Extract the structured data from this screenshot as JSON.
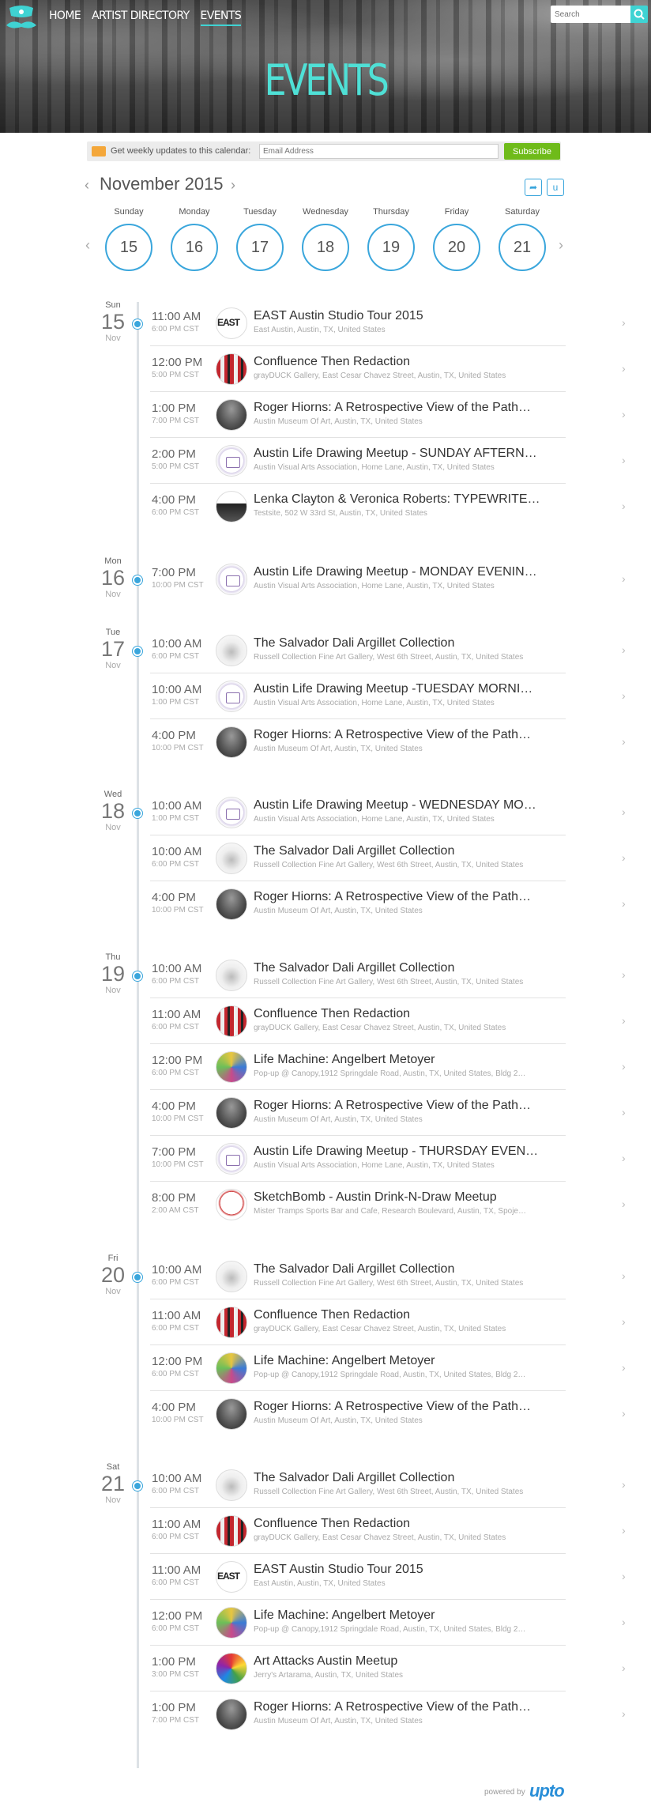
{
  "nav": {
    "items": [
      {
        "label": "HOME",
        "active": false
      },
      {
        "label": "ARTIST DIRECTORY",
        "active": false
      },
      {
        "label": "EVENTS",
        "active": true
      }
    ],
    "search_placeholder": "Search"
  },
  "hero": {
    "title": "EVENTS"
  },
  "subscribe": {
    "label": "Get weekly updates to this calendar:",
    "email_placeholder": "Email Address",
    "button": "Subscribe"
  },
  "calendar": {
    "month": "November 2015",
    "days": [
      {
        "dow": "Sunday",
        "num": "15"
      },
      {
        "dow": "Monday",
        "num": "16"
      },
      {
        "dow": "Tuesday",
        "num": "17"
      },
      {
        "dow": "Wednesday",
        "num": "18"
      },
      {
        "dow": "Thursday",
        "num": "19"
      },
      {
        "dow": "Friday",
        "num": "20"
      },
      {
        "dow": "Saturday",
        "num": "21"
      }
    ]
  },
  "colors": {
    "accent": "#3aa6dc",
    "teal": "#3fd3d3",
    "title": "#4fe0d6",
    "subscribe": "#6fbb1a"
  },
  "schedule": [
    {
      "dow": "Sun",
      "num": "15",
      "mon": "Nov",
      "events": [
        {
          "time": "11:00 AM",
          "end": "6:00 PM CST",
          "title": "EAST Austin Studio Tour 2015",
          "loc": "East Austin, Austin, TX, United States",
          "thumb": "east"
        },
        {
          "time": "12:00 PM",
          "end": "5:00 PM CST",
          "title": "Confluence Then Redaction",
          "loc": "grayDUCK Gallery, East Cesar Chavez Street, Austin, TX, United States",
          "thumb": "conf"
        },
        {
          "time": "1:00 PM",
          "end": "7:00 PM CST",
          "title": "Roger Hiorns: A Retrospective View of the Path…",
          "loc": "Austin Museum Of Art, Austin, TX, United States",
          "thumb": "roger"
        },
        {
          "time": "2:00 PM",
          "end": "5:00 PM CST",
          "title": "Austin Life Drawing Meetup - SUNDAY AFTERN…",
          "loc": "Austin Visual Arts Association, Home Lane, Austin, TX, United States",
          "thumb": "draw"
        },
        {
          "time": "4:00 PM",
          "end": "6:00 PM CST",
          "title": "Lenka Clayton & Veronica Roberts: TYPEWRITE…",
          "loc": "Testsite, 502 W 33rd St, Austin, TX, United States",
          "thumb": "lenka"
        }
      ]
    },
    {
      "dow": "Mon",
      "num": "16",
      "mon": "Nov",
      "events": [
        {
          "time": "7:00 PM",
          "end": "10:00 PM CST",
          "title": "Austin Life Drawing Meetup - MONDAY EVENIN…",
          "loc": "Austin Visual Arts Association, Home Lane, Austin, TX, United States",
          "thumb": "draw"
        }
      ]
    },
    {
      "dow": "Tue",
      "num": "17",
      "mon": "Nov",
      "events": [
        {
          "time": "10:00 AM",
          "end": "6:00 PM CST",
          "title": "The Salvador Dali Argillet Collection",
          "loc": "Russell Collection Fine Art Gallery, West 6th Street, Austin, TX, United States",
          "thumb": "dali"
        },
        {
          "time": "10:00 AM",
          "end": "1:00 PM CST",
          "title": "Austin Life Drawing Meetup -TUESDAY MORNI…",
          "loc": "Austin Visual Arts Association, Home Lane, Austin, TX, United States",
          "thumb": "draw"
        },
        {
          "time": "4:00 PM",
          "end": "10:00 PM CST",
          "title": "Roger Hiorns: A Retrospective View of the Path…",
          "loc": "Austin Museum Of Art, Austin, TX, United States",
          "thumb": "roger"
        }
      ]
    },
    {
      "dow": "Wed",
      "num": "18",
      "mon": "Nov",
      "events": [
        {
          "time": "10:00 AM",
          "end": "1:00 PM CST",
          "title": "Austin Life Drawing Meetup - WEDNESDAY MO…",
          "loc": "Austin Visual Arts Association, Home Lane, Austin, TX, United States",
          "thumb": "draw"
        },
        {
          "time": "10:00 AM",
          "end": "6:00 PM CST",
          "title": "The Salvador Dali Argillet Collection",
          "loc": "Russell Collection Fine Art Gallery, West 6th Street, Austin, TX, United States",
          "thumb": "dali"
        },
        {
          "time": "4:00 PM",
          "end": "10:00 PM CST",
          "title": "Roger Hiorns: A Retrospective View of the Path…",
          "loc": "Austin Museum Of Art, Austin, TX, United States",
          "thumb": "roger"
        }
      ]
    },
    {
      "dow": "Thu",
      "num": "19",
      "mon": "Nov",
      "events": [
        {
          "time": "10:00 AM",
          "end": "6:00 PM CST",
          "title": "The Salvador Dali Argillet Collection",
          "loc": "Russell Collection Fine Art Gallery, West 6th Street, Austin, TX, United States",
          "thumb": "dali"
        },
        {
          "time": "11:00 AM",
          "end": "6:00 PM CST",
          "title": "Confluence Then Redaction",
          "loc": "grayDUCK Gallery, East Cesar Chavez Street, Austin, TX, United States",
          "thumb": "conf"
        },
        {
          "time": "12:00 PM",
          "end": "6:00 PM CST",
          "title": "Life Machine: Angelbert Metoyer",
          "loc": "Pop-up @ Canopy,1912 Springdale Road, Austin, TX, United States, Bldg 2…",
          "thumb": "life"
        },
        {
          "time": "4:00 PM",
          "end": "10:00 PM CST",
          "title": "Roger Hiorns: A Retrospective View of the Path…",
          "loc": "Austin Museum Of Art, Austin, TX, United States",
          "thumb": "roger"
        },
        {
          "time": "7:00 PM",
          "end": "10:00 PM CST",
          "title": "Austin Life Drawing Meetup - THURSDAY EVEN…",
          "loc": "Austin Visual Arts Association, Home Lane, Austin, TX, United States",
          "thumb": "draw"
        },
        {
          "time": "8:00 PM",
          "end": "2:00 AM CST",
          "title": "SketchBomb - Austin Drink-N-Draw Meetup",
          "loc": "Mister Tramps Sports Bar and Cafe, Research Boulevard, Austin, TX, Spoje…",
          "thumb": "sketch"
        }
      ]
    },
    {
      "dow": "Fri",
      "num": "20",
      "mon": "Nov",
      "events": [
        {
          "time": "10:00 AM",
          "end": "6:00 PM CST",
          "title": "The Salvador Dali Argillet Collection",
          "loc": "Russell Collection Fine Art Gallery, West 6th Street, Austin, TX, United States",
          "thumb": "dali"
        },
        {
          "time": "11:00 AM",
          "end": "6:00 PM CST",
          "title": "Confluence Then Redaction",
          "loc": "grayDUCK Gallery, East Cesar Chavez Street, Austin, TX, United States",
          "thumb": "conf"
        },
        {
          "time": "12:00 PM",
          "end": "6:00 PM CST",
          "title": "Life Machine: Angelbert Metoyer",
          "loc": "Pop-up @ Canopy,1912 Springdale Road, Austin, TX, United States, Bldg 2…",
          "thumb": "life"
        },
        {
          "time": "4:00 PM",
          "end": "10:00 PM CST",
          "title": "Roger Hiorns: A Retrospective View of the Path…",
          "loc": "Austin Museum Of Art, Austin, TX, United States",
          "thumb": "roger"
        }
      ]
    },
    {
      "dow": "Sat",
      "num": "21",
      "mon": "Nov",
      "events": [
        {
          "time": "10:00 AM",
          "end": "6:00 PM CST",
          "title": "The Salvador Dali Argillet Collection",
          "loc": "Russell Collection Fine Art Gallery, West 6th Street, Austin, TX, United States",
          "thumb": "dali"
        },
        {
          "time": "11:00 AM",
          "end": "6:00 PM CST",
          "title": "Confluence Then Redaction",
          "loc": "grayDUCK Gallery, East Cesar Chavez Street, Austin, TX, United States",
          "thumb": "conf"
        },
        {
          "time": "11:00 AM",
          "end": "6:00 PM CST",
          "title": "EAST Austin Studio Tour 2015",
          "loc": "East Austin, Austin, TX, United States",
          "thumb": "east"
        },
        {
          "time": "12:00 PM",
          "end": "6:00 PM CST",
          "title": "Life Machine: Angelbert Metoyer",
          "loc": "Pop-up @ Canopy,1912 Springdale Road, Austin, TX, United States, Bldg 2…",
          "thumb": "life"
        },
        {
          "time": "1:00 PM",
          "end": "3:00 PM CST",
          "title": "Art Attacks Austin Meetup",
          "loc": "Jerry's Artarama, Austin, TX, United States",
          "thumb": "artatt"
        },
        {
          "time": "1:00 PM",
          "end": "7:00 PM CST",
          "title": "Roger Hiorns: A Retrospective View of the Path…",
          "loc": "Austin Museum Of Art, Austin, TX, United States",
          "thumb": "roger"
        }
      ]
    }
  ],
  "footer": {
    "powered": "powered by",
    "brand": "upto"
  }
}
